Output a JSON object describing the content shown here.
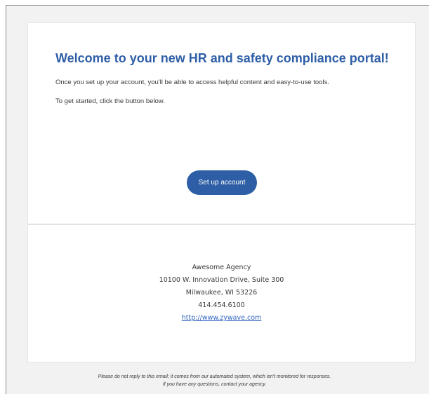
{
  "email": {
    "headline": "Welcome to your new HR and safety compliance portal!",
    "intro_text": "Once you set up your account, you'll be able to access helpful content and easy-to-use tools.",
    "instruction_text": "To get started, click the button below.",
    "setup_button_label": "Set up account"
  },
  "footer": {
    "agency_name": "Awesome Agency",
    "address_line1": "10100 W. Innovation Drive, Suite 300",
    "address_line2": "Milwaukee, WI 53226",
    "phone": "414.454.6100",
    "website": "http://www.zywave.com"
  },
  "disclaimer": {
    "line1": "Please do not reply to this email; it comes from our automated system, which isn't monitored for responses.",
    "line2": "If you have any questions, contact your agency."
  },
  "colors": {
    "accent": "#2e5ea6",
    "link": "#3367c0",
    "background": "#f2f2f2"
  }
}
